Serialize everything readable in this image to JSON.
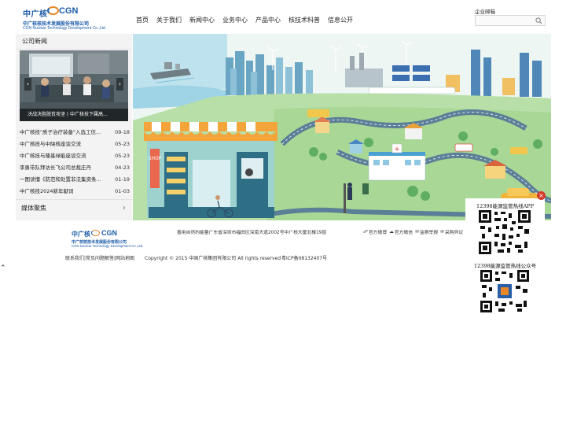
{
  "header": {
    "logo": {
      "mark_cn": "中广核",
      "mark_en": "CGN",
      "company_cn": "中广核核技术发展股份有限公司",
      "company_en": "CGN Nuclear Technology Development Co.,Ltd."
    },
    "nav": [
      "首页",
      "关于我们",
      "新闻中心",
      "业务中心",
      "产品中心",
      "核技术科普",
      "信息公开"
    ],
    "mail_label": "企业邮箱",
    "search": {
      "placeholder": "",
      "value": ""
    }
  },
  "sidebar": {
    "title": "公司新闻",
    "photo_caption": "决战决胜脱贫攻坚丨中广核技下属高...",
    "news": [
      {
        "title": "中广核技\"质子治疗装备\"入选工信...",
        "date": "09-18"
      },
      {
        "title": "中广核技与中陕核座谈交流",
        "date": "05-23"
      },
      {
        "title": "中广核技与隆基绿能座谈交流",
        "date": "05-23"
      },
      {
        "title": "李勇带队拜访长飞公司总裁庄丹",
        "date": "04-23"
      },
      {
        "title": "一图读懂《防范和处置非法集资条...",
        "date": "01-19"
      },
      {
        "title": "中广核技2024新年献词",
        "date": "01-03"
      }
    ],
    "media_title": "媒体聚焦"
  },
  "banner": {
    "shop_sign": "SHOP",
    "hospital_sign": "+"
  },
  "footer": {
    "logo_cn": "中广核核技术发展股份有限公司",
    "logo_en": "CGN Nuclear Technology Development Co.,Ltd.",
    "address": "善用自然的能量广东省深圳市福田区深南大道2002号中广核大厦北楼19层",
    "links": [
      "官方微博",
      "官方微信",
      "监察举报",
      "采购异议"
    ],
    "bottom_links": "联系我们|常见问题解答|网站地图",
    "copyright": "Copyright © 2015 中国广核集团有限公司 All rights reserved",
    "icp": "粤ICP备08132407号",
    "back_top": "⌃"
  },
  "qr": {
    "app_label": "12398能源监管热线APP",
    "wechat_label": "12398能源监管热线公众号",
    "close": "×"
  },
  "colors": {
    "brand_blue": "#1a5aa8",
    "brand_orange": "#e8872a",
    "close_red": "#d63a2a"
  }
}
